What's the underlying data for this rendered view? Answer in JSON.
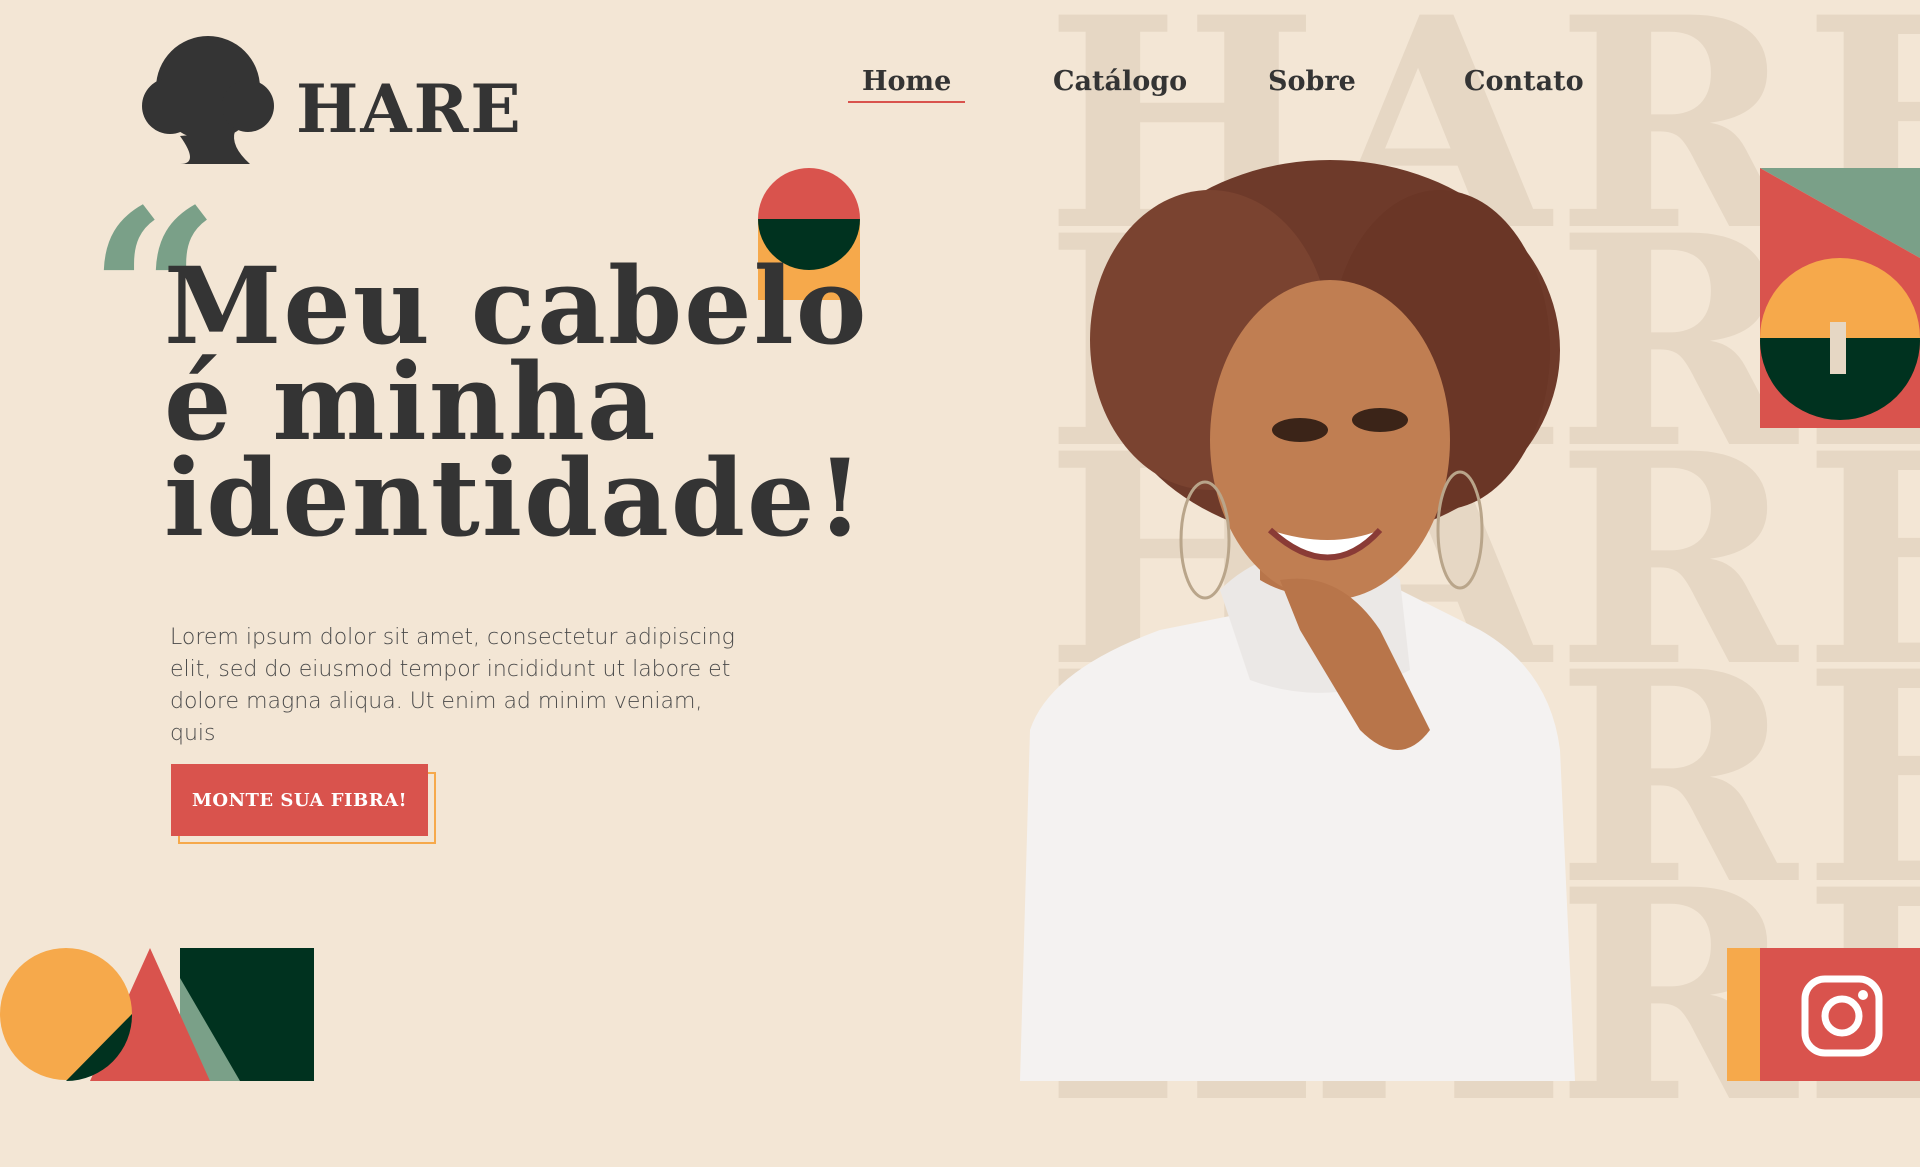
{
  "brand": {
    "name": "HARE"
  },
  "nav": {
    "items": [
      {
        "label": "Home",
        "active": true
      },
      {
        "label": "Catálogo",
        "active": false
      },
      {
        "label": "Sobre",
        "active": false
      },
      {
        "label": "Contato",
        "active": false
      }
    ]
  },
  "hero": {
    "quote_mark": "“",
    "title_lines": [
      "Meu cabelo",
      "é minha",
      "identidade!"
    ],
    "text_lines": [
      "Lorem ipsum dolor sit amet, consectetur adipiscing",
      "elit, sed do eiusmod tempor incididunt ut labore et",
      "dolore magna aliqua. Ut enim ad minim veniam, quis"
    ],
    "cta_label": "MONTE SUA FIBRA!"
  },
  "background": {
    "watermark_word": "HARE"
  },
  "social": {
    "icon": "instagram-icon"
  },
  "colors": {
    "background": "#f3e6d5",
    "text": "#343434",
    "red": "#d9534d",
    "orange": "#f6a94b",
    "dark_green": "#00321f",
    "sage": "#7aa088",
    "watermark": "#e6d7c4"
  }
}
